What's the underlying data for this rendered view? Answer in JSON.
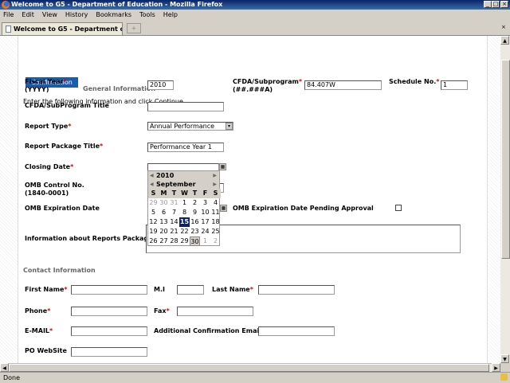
{
  "window": {
    "title": "Welcome to G5 - Department of Education - Mozilla Firefox"
  },
  "menu": [
    "File",
    "Edit",
    "View",
    "History",
    "Bookmarks",
    "Tools",
    "Help"
  ],
  "tab": {
    "label": "Welcome to G5 - Department of Edu...",
    "new_tab": "+"
  },
  "page": {
    "confirmation_button": "Confirmation",
    "section_general": "General Information",
    "instructions": "Enter the following information and click Continue",
    "fiscal_year": {
      "label": "Fiscal Year",
      "sub": "(YYYY)",
      "value": "2010"
    },
    "cfda": {
      "label": "CFDA/Subprogram",
      "sub": "(##.###A)",
      "value": "84.407W"
    },
    "schedule": {
      "label": "Schedule No.",
      "value": "1"
    },
    "cfda_title": {
      "label": "CFDA/SubProgram Title",
      "value": ""
    },
    "report_type": {
      "label": "Report Type",
      "value": "Annual Performance"
    },
    "report_package_title": {
      "label": "Report Package Title",
      "value": "Performance Year 1"
    },
    "closing_date": {
      "label": "Closing Date",
      "value": ""
    },
    "omb_control": {
      "label": "OMB Control No.",
      "sub": "(1840-0001)"
    },
    "omb_expiration": {
      "label": "OMB Expiration Date"
    },
    "omb_pending": {
      "label": "OMB Expiration Date Pending Approval",
      "checked": false
    },
    "info_package": {
      "label": "Information about Reports Package",
      "value": ""
    },
    "section_contact": "Contact Information",
    "first_name": {
      "label": "First Name"
    },
    "mi": {
      "label": "M.I"
    },
    "last_name": {
      "label": "Last Name"
    },
    "phone": {
      "label": "Phone"
    },
    "fax": {
      "label": "Fax"
    },
    "email": {
      "label": "E-MAIL"
    },
    "additional_email": {
      "label": "Additional Confirmation Email"
    },
    "po_website": {
      "label": "PO WebSite"
    },
    "required_mark": "*"
  },
  "calendar": {
    "year": "2010",
    "month": "September",
    "weekdays": [
      "S",
      "M",
      "T",
      "W",
      "T",
      "F",
      "S"
    ],
    "days": [
      "29",
      "30",
      "31",
      "1",
      "2",
      "3",
      "4",
      "5",
      "6",
      "7",
      "8",
      "9",
      "10",
      "11",
      "12",
      "13",
      "14",
      "15",
      "16",
      "17",
      "18",
      "19",
      "20",
      "21",
      "22",
      "23",
      "24",
      "25",
      "26",
      "27",
      "28",
      "29",
      "30",
      "1",
      "2"
    ],
    "selected": "15",
    "today": "30"
  },
  "status": {
    "text": "Done"
  }
}
